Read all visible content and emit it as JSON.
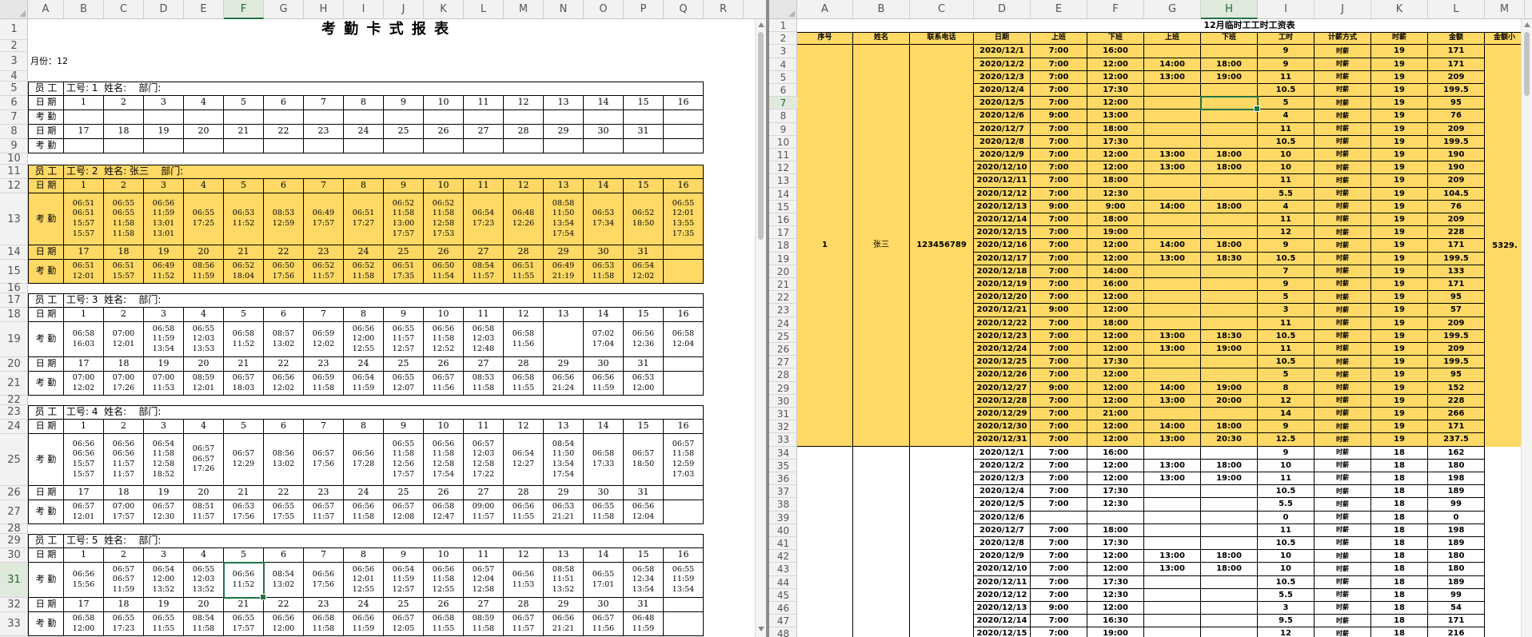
{
  "left": {
    "cols": [
      "A",
      "B",
      "C",
      "D",
      "E",
      "F",
      "G",
      "H",
      "I",
      "J",
      "K",
      "L",
      "M",
      "N",
      "O",
      "P",
      "Q",
      "R"
    ],
    "selected_col": "F",
    "selected_row": 31,
    "title": "考 勤 卡 式 报 表",
    "month_label": "月份：12",
    "days_first": [
      "1",
      "2",
      "3",
      "4",
      "5",
      "6",
      "7",
      "8",
      "9",
      "10",
      "11",
      "12",
      "13",
      "14",
      "15",
      "16"
    ],
    "days_second": [
      "17",
      "18",
      "19",
      "20",
      "21",
      "22",
      "23",
      "24",
      "25",
      "26",
      "27",
      "28",
      "29",
      "30",
      "31",
      ""
    ],
    "labels": {
      "employee": "员 工",
      "date": "日 期",
      "attendance": "考 勤"
    },
    "employees": [
      {
        "header": "工号: 1  姓名:    部门:",
        "highlight": false,
        "att1": [
          "",
          "",
          "",
          "",
          "",
          "",
          "",
          "",
          "",
          "",
          "",
          "",
          "",
          "",
          "",
          ""
        ],
        "att2": [
          "",
          "",
          "",
          "",
          "",
          "",
          "",
          "",
          "",
          "",
          "",
          "",
          "",
          "",
          "",
          ""
        ]
      },
      {
        "header": "工号: 2  姓名: 张三    部门:",
        "highlight": true,
        "att1": [
          "06:51\n06:51\n15:57\n15:57",
          "06:55\n06:55\n11:58\n11:58",
          "06:56\n11:59\n13:01\n13:01",
          "06:55\n17:25",
          "06:53\n11:52",
          "08:53\n12:59",
          "06:49\n17:57",
          "06:51\n17:27",
          "06:52\n11:58\n13:00\n17:57",
          "06:52\n11:58\n12:58\n17:53",
          "06:54\n17:23",
          "06:48\n12:26",
          "08:58\n11:50\n13:54\n17:54",
          "06:53\n17:34",
          "06:52\n18:50",
          "06:55\n12:01\n13:55\n17:35"
        ],
        "att2": [
          "06:51\n12:01",
          "06:51\n15:57",
          "06:49\n11:52",
          "08:56\n11:59",
          "06:52\n18:04",
          "06:50\n17:56",
          "06:52\n11:57",
          "06:52\n11:58",
          "06:51\n17:35",
          "06:50\n11:54",
          "08:54\n11:57",
          "06:51\n11:55",
          "06:49\n21:19",
          "06:53\n11:58",
          "06:54\n12:02",
          ""
        ]
      },
      {
        "header": "工号: 3  姓名:    部门:",
        "highlight": false,
        "att1": [
          "06:58\n16:03",
          "07:00\n12:01",
          "06:58\n11:59\n13:54",
          "06:55\n12:03\n13:53",
          "06:58\n11:52",
          "08:57\n13:02",
          "06:59\n12:02",
          "06:56\n12:00\n12:55",
          "06:55\n11:57\n12:57",
          "06:56\n11:58\n12:52",
          "06:58\n12:03\n12:48",
          "06:58\n11:56",
          "",
          "07:02\n17:04",
          "06:56\n12:36",
          "06:58\n12:04"
        ],
        "att2": [
          "07:00\n12:02",
          "07:00\n17:26",
          "07:00\n11:53",
          "08:59\n12:01",
          "06:57\n18:03",
          "06:56\n12:02",
          "06:59\n11:58",
          "06:54\n11:59",
          "06:55\n12:07",
          "06:57\n11:56",
          "08:53\n11:58",
          "06:58\n11:55",
          "06:56\n21:24",
          "06:56\n11:59",
          "06:53\n12:00",
          ""
        ]
      },
      {
        "header": "工号: 4  姓名:    部门:",
        "highlight": false,
        "att1": [
          "06:56\n06:56\n15:57\n15:57",
          "06:56\n06:56\n11:57\n11:57",
          "06:54\n11:58\n12:58\n18:52",
          "06:57\n06:57\n17:26",
          "06:57\n12:29",
          "08:56\n13:02",
          "06:57\n17:56",
          "06:56\n17:28",
          "06:55\n11:58\n12:56\n17:57",
          "06:56\n11:58\n12:58\n17:54",
          "06:57\n12:03\n12:58\n17:22",
          "06:54\n12:27",
          "08:54\n11:50\n13:54\n17:54",
          "06:58\n17:33",
          "06:57\n18:50",
          "06:57\n11:58\n12:59\n17:03"
        ],
        "att2": [
          "06:57\n12:01",
          "07:00\n17:57",
          "06:57\n12:30",
          "08:51\n11:57",
          "06:53\n17:56",
          "06:55\n17:55",
          "06:57\n11:57",
          "06:56\n11:58",
          "06:57\n12:08",
          "06:58\n12:47",
          "09:00\n11:57",
          "06:56\n11:55",
          "06:53\n21:21",
          "06:55\n11:58",
          "06:56\n12:04",
          ""
        ]
      },
      {
        "header": "工号: 5  姓名:    部门:",
        "highlight": false,
        "att1": [
          "06:56\n15:56",
          "06:57\n06:57\n11:59",
          "06:54\n12:00\n13:52",
          "06:55\n12:03\n13:52",
          "06:56\n11:52",
          "08:54\n13:02",
          "06:56\n17:56",
          "06:56\n12:01\n12:55",
          "06:54\n11:59\n12:57",
          "06:56\n11:58\n12:55",
          "06:57\n12:04\n12:58",
          "06:56\n11:53",
          "08:58\n11:51\n13:52",
          "06:55\n17:01",
          "06:58\n12:34\n13:54",
          "06:55\n11:59\n13:54"
        ],
        "att2": [
          "06:58\n12:00",
          "06:55\n17:23",
          "06:55\n11:55",
          "08:54\n11:58",
          "06:55\n17:57",
          "06:56\n12:00",
          "06:58\n11:58",
          "06:56\n11:59",
          "06:57\n12:05",
          "06:58\n11:55",
          "08:59\n11:58",
          "06:57\n11:57",
          "06:56\n21:21",
          "06:57\n11:56",
          "06:48\n11:59",
          ""
        ]
      }
    ]
  },
  "right": {
    "cols": [
      "A",
      "B",
      "C",
      "D",
      "E",
      "F",
      "G",
      "H",
      "I",
      "J",
      "K",
      "L",
      "M"
    ],
    "selected_col": "H",
    "selected_row": 7,
    "title": "12月临时工工时工资表",
    "headers": [
      "序号",
      "姓名",
      "联系电话",
      "日期",
      "上班",
      "下班",
      "上班",
      "下班",
      "工时",
      "计薪方式",
      "时薪",
      "金额",
      "金额小"
    ],
    "group": {
      "seq": "1",
      "name": "张三",
      "phone": "123456789",
      "total": "5329."
    },
    "rows1": [
      [
        "2020/12/1",
        "7:00",
        "16:00",
        "",
        "",
        "9",
        "时薪",
        "19",
        "171"
      ],
      [
        "2020/12/2",
        "7:00",
        "12:00",
        "14:00",
        "18:00",
        "9",
        "时薪",
        "19",
        "171"
      ],
      [
        "2020/12/3",
        "7:00",
        "12:00",
        "13:00",
        "19:00",
        "11",
        "时薪",
        "19",
        "209"
      ],
      [
        "2020/12/4",
        "7:00",
        "17:30",
        "",
        "",
        "10.5",
        "时薪",
        "19",
        "199.5"
      ],
      [
        "2020/12/5",
        "7:00",
        "12:00",
        "",
        "",
        "5",
        "时薪",
        "19",
        "95"
      ],
      [
        "2020/12/6",
        "9:00",
        "13:00",
        "",
        "",
        "4",
        "时薪",
        "19",
        "76"
      ],
      [
        "2020/12/7",
        "7:00",
        "18:00",
        "",
        "",
        "11",
        "时薪",
        "19",
        "209"
      ],
      [
        "2020/12/8",
        "7:00",
        "17:30",
        "",
        "",
        "10.5",
        "时薪",
        "19",
        "199.5"
      ],
      [
        "2020/12/9",
        "7:00",
        "12:00",
        "13:00",
        "18:00",
        "10",
        "时薪",
        "19",
        "190"
      ],
      [
        "2020/12/10",
        "7:00",
        "12:00",
        "13:00",
        "18:00",
        "10",
        "时薪",
        "19",
        "190"
      ],
      [
        "2020/12/11",
        "7:00",
        "18:00",
        "",
        "",
        "11",
        "时薪",
        "19",
        "209"
      ],
      [
        "2020/12/12",
        "7:00",
        "12:30",
        "",
        "",
        "5.5",
        "时薪",
        "19",
        "104.5"
      ],
      [
        "2020/12/13",
        "9:00",
        "9:00",
        "14:00",
        "18:00",
        "4",
        "时薪",
        "19",
        "76"
      ],
      [
        "2020/12/14",
        "7:00",
        "18:00",
        "",
        "",
        "11",
        "时薪",
        "19",
        "209"
      ],
      [
        "2020/12/15",
        "7:00",
        "19:00",
        "",
        "",
        "12",
        "时薪",
        "19",
        "228"
      ],
      [
        "2020/12/16",
        "7:00",
        "12:00",
        "14:00",
        "18:00",
        "9",
        "时薪",
        "19",
        "171"
      ],
      [
        "2020/12/17",
        "7:00",
        "12:00",
        "13:00",
        "18:30",
        "10.5",
        "时薪",
        "19",
        "199.5"
      ],
      [
        "2020/12/18",
        "7:00",
        "14:00",
        "",
        "",
        "7",
        "时薪",
        "19",
        "133"
      ],
      [
        "2020/12/19",
        "7:00",
        "16:00",
        "",
        "",
        "9",
        "时薪",
        "19",
        "171"
      ],
      [
        "2020/12/20",
        "7:00",
        "12:00",
        "",
        "",
        "5",
        "时薪",
        "19",
        "95"
      ],
      [
        "2020/12/21",
        "9:00",
        "12:00",
        "",
        "",
        "3",
        "时薪",
        "19",
        "57"
      ],
      [
        "2020/12/22",
        "7:00",
        "18:00",
        "",
        "",
        "11",
        "时薪",
        "19",
        "209"
      ],
      [
        "2020/12/23",
        "7:00",
        "12:00",
        "13:00",
        "18:30",
        "10.5",
        "时薪",
        "19",
        "199.5"
      ],
      [
        "2020/12/24",
        "7:00",
        "12:00",
        "13:00",
        "19:00",
        "11",
        "时薪",
        "19",
        "209"
      ],
      [
        "2020/12/25",
        "7:00",
        "17:30",
        "",
        "",
        "10.5",
        "时薪",
        "19",
        "199.5"
      ],
      [
        "2020/12/26",
        "7:00",
        "12:00",
        "",
        "",
        "5",
        "时薪",
        "19",
        "95"
      ],
      [
        "2020/12/27",
        "9:00",
        "12:00",
        "14:00",
        "19:00",
        "8",
        "时薪",
        "19",
        "152"
      ],
      [
        "2020/12/28",
        "7:00",
        "12:00",
        "13:00",
        "20:00",
        "12",
        "时薪",
        "19",
        "228"
      ],
      [
        "2020/12/29",
        "7:00",
        "21:00",
        "",
        "",
        "14",
        "时薪",
        "19",
        "266"
      ],
      [
        "2020/12/30",
        "7:00",
        "12:00",
        "14:00",
        "18:00",
        "9",
        "时薪",
        "19",
        "171"
      ],
      [
        "2020/12/31",
        "7:00",
        "12:00",
        "13:00",
        "20:30",
        "12.5",
        "时薪",
        "19",
        "237.5"
      ]
    ],
    "rows2": [
      [
        "2020/12/1",
        "7:00",
        "16:00",
        "",
        "",
        "9",
        "时薪",
        "18",
        "162"
      ],
      [
        "2020/12/2",
        "7:00",
        "12:00",
        "13:00",
        "18:00",
        "10",
        "时薪",
        "18",
        "180"
      ],
      [
        "2020/12/3",
        "7:00",
        "12:00",
        "13:00",
        "19:00",
        "11",
        "时薪",
        "18",
        "198"
      ],
      [
        "2020/12/4",
        "7:00",
        "17:30",
        "",
        "",
        "10.5",
        "时薪",
        "18",
        "189"
      ],
      [
        "2020/12/5",
        "7:00",
        "12:30",
        "",
        "",
        "5.5",
        "时薪",
        "18",
        "99"
      ],
      [
        "2020/12/6",
        "",
        "",
        "",
        "",
        "0",
        "时薪",
        "18",
        "0"
      ],
      [
        "2020/12/7",
        "7:00",
        "18:00",
        "",
        "",
        "11",
        "时薪",
        "18",
        "198"
      ],
      [
        "2020/12/8",
        "7:00",
        "17:30",
        "",
        "",
        "10.5",
        "时薪",
        "18",
        "189"
      ],
      [
        "2020/12/9",
        "7:00",
        "12:00",
        "13:00",
        "18:00",
        "10",
        "时薪",
        "18",
        "180"
      ],
      [
        "2020/12/10",
        "7:00",
        "12:00",
        "13:00",
        "18:00",
        "10",
        "时薪",
        "18",
        "180"
      ],
      [
        "2020/12/11",
        "7:00",
        "17:30",
        "",
        "",
        "10.5",
        "时薪",
        "18",
        "189"
      ],
      [
        "2020/12/12",
        "7:00",
        "12:30",
        "",
        "",
        "5.5",
        "时薪",
        "18",
        "99"
      ],
      [
        "2020/12/13",
        "9:00",
        "12:00",
        "",
        "",
        "3",
        "时薪",
        "18",
        "54"
      ],
      [
        "2020/12/14",
        "7:00",
        "16:30",
        "",
        "",
        "9.5",
        "时薪",
        "18",
        "171"
      ],
      [
        "2020/12/15",
        "7:00",
        "19:00",
        "",
        "",
        "12",
        "时薪",
        "18",
        "216"
      ]
    ]
  }
}
